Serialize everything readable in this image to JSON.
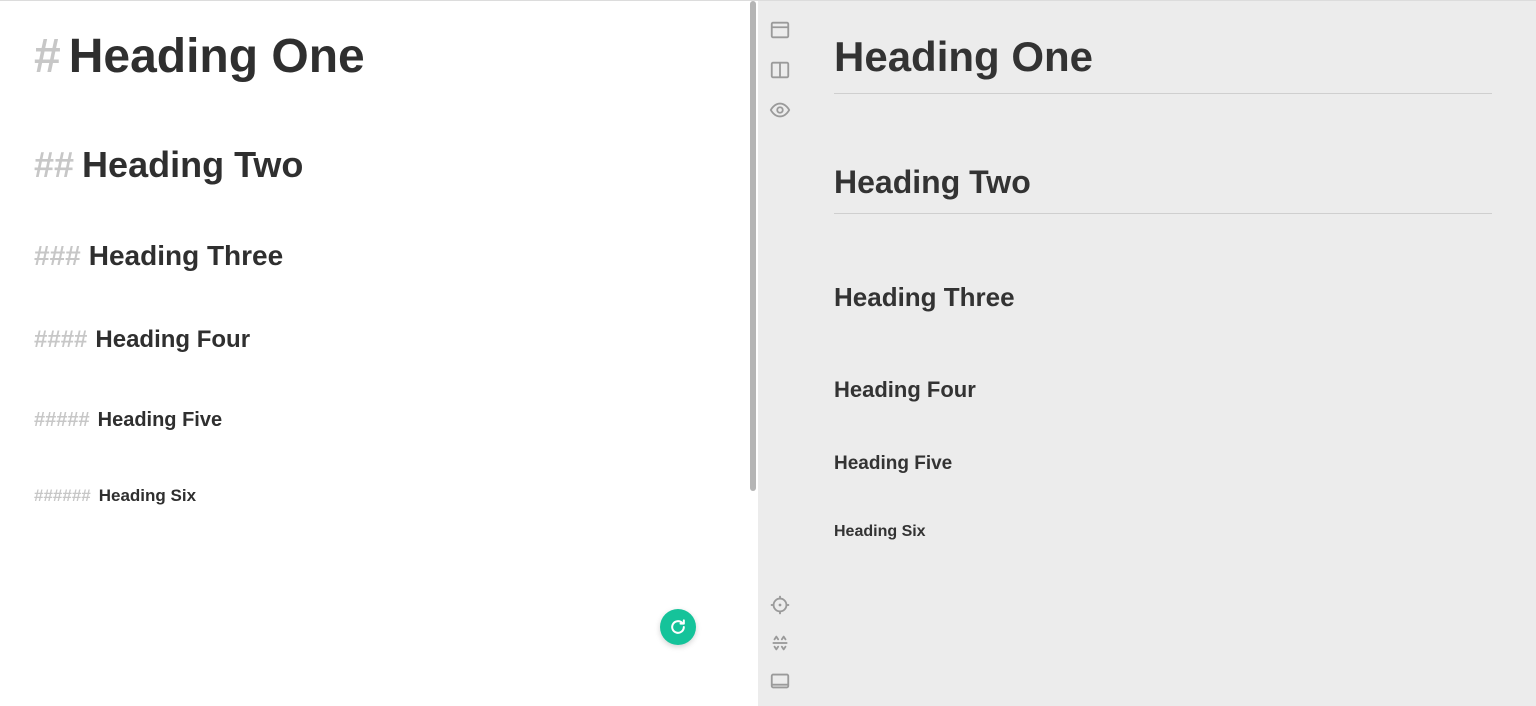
{
  "editor": {
    "lines": [
      {
        "level": 1,
        "hash": "#",
        "text": "Heading One"
      },
      {
        "level": 2,
        "hash": "##",
        "text": "Heading Two"
      },
      {
        "level": 3,
        "hash": "###",
        "text": "Heading Three"
      },
      {
        "level": 4,
        "hash": "####",
        "text": "Heading Four"
      },
      {
        "level": 5,
        "hash": "#####",
        "text": "Heading Five"
      },
      {
        "level": 6,
        "hash": "######",
        "text": "Heading Six"
      }
    ]
  },
  "preview": {
    "h1": "Heading One",
    "h2": "Heading Two",
    "h3": "Heading Three",
    "h4": "Heading Four",
    "h5": "Heading Five",
    "h6": "Heading Six"
  },
  "toolbar": {
    "top": [
      {
        "name": "layout-top-icon"
      },
      {
        "name": "layout-split-icon"
      },
      {
        "name": "preview-eye-icon"
      }
    ],
    "bottom": [
      {
        "name": "sync-scroll-target-icon"
      },
      {
        "name": "scroll-sync-arrows-icon"
      },
      {
        "name": "fullscreen-icon"
      }
    ]
  },
  "badge": {
    "name": "grammarly"
  }
}
